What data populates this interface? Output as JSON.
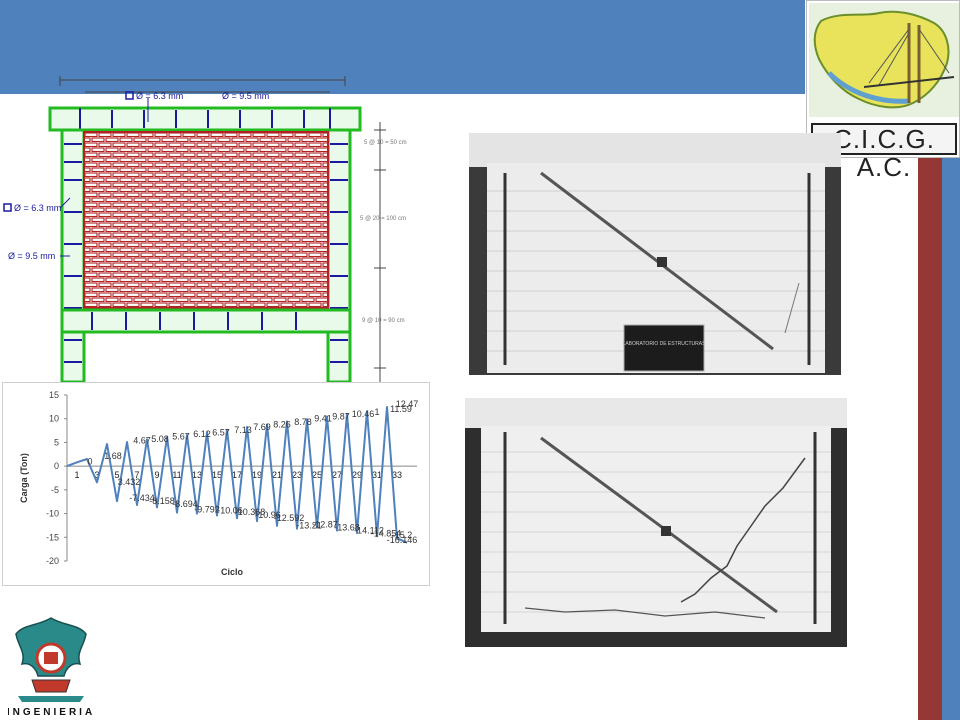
{
  "header": {
    "band_color": "#4f81bd"
  },
  "logo": {
    "caption": "C.I.C.G. A.C.",
    "icon": "chiapas-map-bridge-logo"
  },
  "side_bars": {
    "red": "#953735",
    "blue": "#4f81bd"
  },
  "drawing": {
    "labels": {
      "bar_top_small": "Ø = 6.3 mm",
      "bar_top_large": "Ø = 9.5 mm",
      "bar_left_small": "Ø = 6.3 mm",
      "bar_left_large": "Ø = 9.5 mm",
      "spacing_top": "5 @ 10 = 50 cm",
      "spacing_middle": "5 @ 20 = 100 cm",
      "spacing_bottom": "9 @ 10 = 90 cm"
    },
    "colors": {
      "brick": "#b22222",
      "frame": "#22bb22",
      "rebar": "#1a1aa0"
    }
  },
  "chart_data": {
    "type": "line",
    "xlabel": "Ciclo",
    "ylabel": "Carga (Ton)",
    "ylim": [
      -20,
      15
    ],
    "xlim": [
      0,
      35
    ],
    "yticks": [
      15,
      10,
      5,
      0,
      -5,
      -10,
      -15,
      -20
    ],
    "xticks": [
      1,
      3,
      5,
      7,
      9,
      11,
      13,
      15,
      17,
      19,
      21,
      23,
      25,
      27,
      29,
      31,
      33
    ],
    "grid": false,
    "legend": "none",
    "series_color": "#4f81bd",
    "x": [
      0,
      1,
      2,
      3,
      4,
      5,
      6,
      7,
      8,
      9,
      10,
      11,
      12,
      13,
      14,
      15,
      16,
      17,
      18,
      19,
      20,
      21,
      22,
      23,
      24,
      25,
      26,
      27,
      28,
      29,
      30,
      31,
      32,
      33,
      34
    ],
    "values": [
      0,
      0.8,
      1.5,
      -3.4,
      4.67,
      -7.4,
      5.08,
      -8.2,
      5.67,
      -8.7,
      6.12,
      -9.8,
      6.57,
      -10.0,
      7.13,
      -10.4,
      7.69,
      -11.0,
      8.26,
      -11.6,
      8.78,
      -12.6,
      9.41,
      -13.2,
      9.87,
      -12.9,
      10.46,
      -13.6,
      11.0,
      -14.1,
      11.59,
      -14.8,
      12.47,
      -15.2,
      -16.146
    ],
    "data_labels": [
      {
        "x": 2.3,
        "y": 0.3,
        "text": "0"
      },
      {
        "x": 4.6,
        "y": 1.5,
        "text": "1.68"
      },
      {
        "x": 6.2,
        "y": -4.0,
        "text": "3.432"
      },
      {
        "x": 7.5,
        "y": 4.8,
        "text": "4.67"
      },
      {
        "x": 9.3,
        "y": 5.1,
        "text": "5.08"
      },
      {
        "x": 11.4,
        "y": 5.6,
        "text": "5.67"
      },
      {
        "x": 13.5,
        "y": 6.1,
        "text": "6.12"
      },
      {
        "x": 15.4,
        "y": 6.5,
        "text": "6.57"
      },
      {
        "x": 17.6,
        "y": 7.0,
        "text": "7.13"
      },
      {
        "x": 19.5,
        "y": 7.6,
        "text": "7.69"
      },
      {
        "x": 21.5,
        "y": 8.1,
        "text": "8.26"
      },
      {
        "x": 23.6,
        "y": 8.7,
        "text": "8.78"
      },
      {
        "x": 25.6,
        "y": 9.4,
        "text": "9.41"
      },
      {
        "x": 27.4,
        "y": 9.8,
        "text": "9.87"
      },
      {
        "x": 29.6,
        "y": 10.4,
        "text": "10.46"
      },
      {
        "x": 31.0,
        "y": 10.8,
        "text": "1"
      },
      {
        "x": 33.4,
        "y": 11.4,
        "text": "11.59"
      },
      {
        "x": 34.0,
        "y": 12.5,
        "text": "12.47"
      },
      {
        "x": 7.5,
        "y": -7.4,
        "text": "-7.434"
      },
      {
        "x": 9.5,
        "y": -8.0,
        "text": "-8.158"
      },
      {
        "x": 11.8,
        "y": -8.6,
        "text": "-8.694"
      },
      {
        "x": 14.0,
        "y": -9.8,
        "text": "-9.792"
      },
      {
        "x": 16.3,
        "y": -10.0,
        "text": "-10.06"
      },
      {
        "x": 18.3,
        "y": -10.3,
        "text": "-10.368"
      },
      {
        "x": 20.1,
        "y": -10.9,
        "text": "-10.96"
      },
      {
        "x": 22.2,
        "y": -11.6,
        "text": "-12.592"
      },
      {
        "x": 24.2,
        "y": -13.1,
        "text": "-13.21"
      },
      {
        "x": 25.8,
        "y": -12.9,
        "text": "-12.87"
      },
      {
        "x": 28.0,
        "y": -13.6,
        "text": "-13.68"
      },
      {
        "x": 30.2,
        "y": -14.2,
        "text": "-14.112"
      },
      {
        "x": 31.9,
        "y": -14.8,
        "text": "-14.854"
      },
      {
        "x": 33.5,
        "y": -15.2,
        "text": "-15.2"
      },
      {
        "x": 33.5,
        "y": -16.2,
        "text": "-16.146"
      }
    ]
  },
  "photos": {
    "top": {
      "sign": "LABORATORIO DE ESTRUCTURAS"
    },
    "bottom": {}
  },
  "emblem": {
    "text": "INGENIERIA",
    "icon": "engineering-eagle-emblem"
  }
}
